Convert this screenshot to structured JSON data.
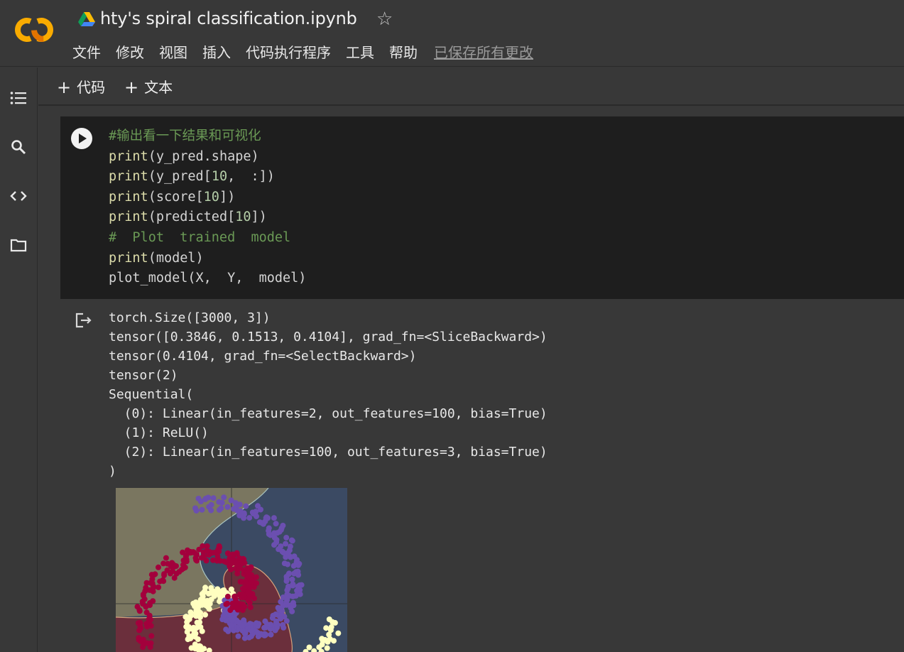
{
  "header": {
    "title": "hty's spiral classification.ipynb",
    "menu": [
      "文件",
      "修改",
      "视图",
      "插入",
      "代码执行程序",
      "工具",
      "帮助"
    ],
    "saved_status": "已保存所有更改"
  },
  "toolbar": {
    "add_code_label": "代码",
    "add_text_label": "文本"
  },
  "sidebar": {
    "icons": [
      "table-of-contents-icon",
      "search-icon",
      "code-snippets-icon",
      "files-icon"
    ]
  },
  "cell": {
    "lines": [
      "#输出看一下结果和可视化",
      "print(y_pred.shape)",
      "print(y_pred[10,  :])",
      "print(score[10])",
      "print(predicted[10])",
      "#  Plot  trained  model",
      "print(model)",
      "plot_model(X,  Y,  model)"
    ]
  },
  "output": {
    "lines": [
      "torch.Size([3000, 3])",
      "tensor([0.3846, 0.1513, 0.4104], grad_fn=<SliceBackward>)",
      "tensor(0.4104, grad_fn=<SelectBackward>)",
      "tensor(2)",
      "Sequential(",
      "  (0): Linear(in_features=2, out_features=100, bias=True)",
      "  (1): ReLU()",
      "  (2): Linear(in_features=100, out_features=3, bias=True)",
      ")"
    ]
  },
  "colors": {
    "background": "#383838",
    "cell_background": "#1e1e1e",
    "class_yellow": "#ffffc0",
    "class_purple": "#6b4fb0",
    "class_red": "#a3003c",
    "region_khaki": "#7a7660",
    "region_slate": "#3b4a63",
    "region_maroon": "#6b2f3c"
  }
}
